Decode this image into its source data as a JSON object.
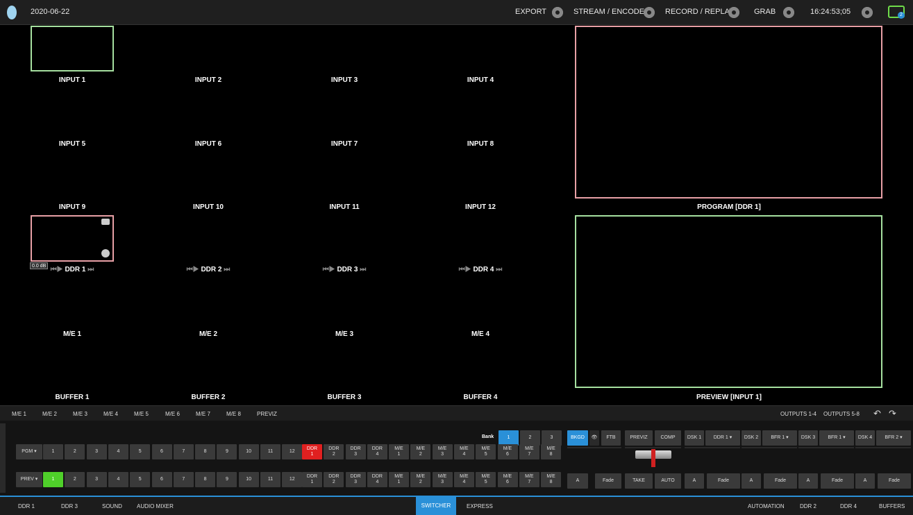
{
  "topbar": {
    "date": "2020-06-22",
    "export": "EXPORT",
    "stream": "STREAM / ENCODE",
    "record": "RECORD / REPLAY",
    "grab": "GRAB",
    "time": "16:24:53;05",
    "notifications": "2"
  },
  "monitors": {
    "inputs": [
      "INPUT 1",
      "INPUT 2",
      "INPUT 3",
      "INPUT 4",
      "INPUT 5",
      "INPUT 6",
      "INPUT 7",
      "INPUT 8",
      "INPUT 9",
      "INPUT 10",
      "INPUT 11",
      "INPUT 12"
    ],
    "ddrs": [
      "DDR 1",
      "DDR 2",
      "DDR 3",
      "DDR 4"
    ],
    "ddr_level": "0.0 dB",
    "mes": [
      "M/E 1",
      "M/E 2",
      "M/E 3",
      "M/E 4"
    ],
    "buffers": [
      "BUFFER 1",
      "BUFFER 2",
      "BUFFER 3",
      "BUFFER 4"
    ],
    "program": "PROGRAM [DDR 1]",
    "preview": "PREVIEW [INPUT 1]"
  },
  "me_tabs": [
    "M/E 1",
    "M/E 2",
    "M/E 3",
    "M/E 4",
    "M/E 5",
    "M/E 6",
    "M/E 7",
    "M/E 8",
    "PREVIZ"
  ],
  "outputs": {
    "o1": "OUTPUTS 1-4",
    "o2": "OUTPUTS 5-8"
  },
  "switcher": {
    "pgm": "PGM",
    "prev": "PREV",
    "bank_label": "Bank",
    "banks": [
      "1",
      "2",
      "3"
    ],
    "nums": [
      "1",
      "2",
      "3",
      "4",
      "5",
      "6",
      "7",
      "8",
      "9",
      "10",
      "11",
      "12"
    ],
    "ddr_top": [
      "DDR",
      "DDR",
      "DDR",
      "DDR"
    ],
    "ddr_bot": [
      "1",
      "2",
      "3",
      "4"
    ],
    "me_top": [
      "M/E",
      "M/E",
      "M/E",
      "M/E",
      "M/E",
      "M/E",
      "M/E",
      "M/E"
    ],
    "me_bot": [
      "1",
      "2",
      "3",
      "4",
      "5",
      "6",
      "7",
      "8"
    ],
    "bkgd": "BKGD",
    "ftb": "FTB",
    "previz": "PREVIZ",
    "comp": "COMP",
    "take": "TAKE",
    "auto": "AUTO",
    "fade": "Fade",
    "dsk": [
      {
        "name": "DSK 1",
        "src": "DDR 1"
      },
      {
        "name": "DSK 2",
        "src": "BFR 1"
      },
      {
        "name": "DSK 3",
        "src": "BFR 1"
      },
      {
        "name": "DSK 4",
        "src": "BFR 2"
      }
    ]
  },
  "bottom": {
    "left": [
      "DDR 1",
      "DDR 3",
      "SOUND",
      "AUDIO MIXER"
    ],
    "switcher": "SWITCHER",
    "express": "EXPRESS",
    "right": [
      "AUTOMATION",
      "DDR 2",
      "DDR 4",
      "BUFFERS"
    ]
  },
  "colors": {
    "accent": "#2a90d8",
    "program": "#e8a0a6",
    "preview": "#a6e0a0"
  }
}
